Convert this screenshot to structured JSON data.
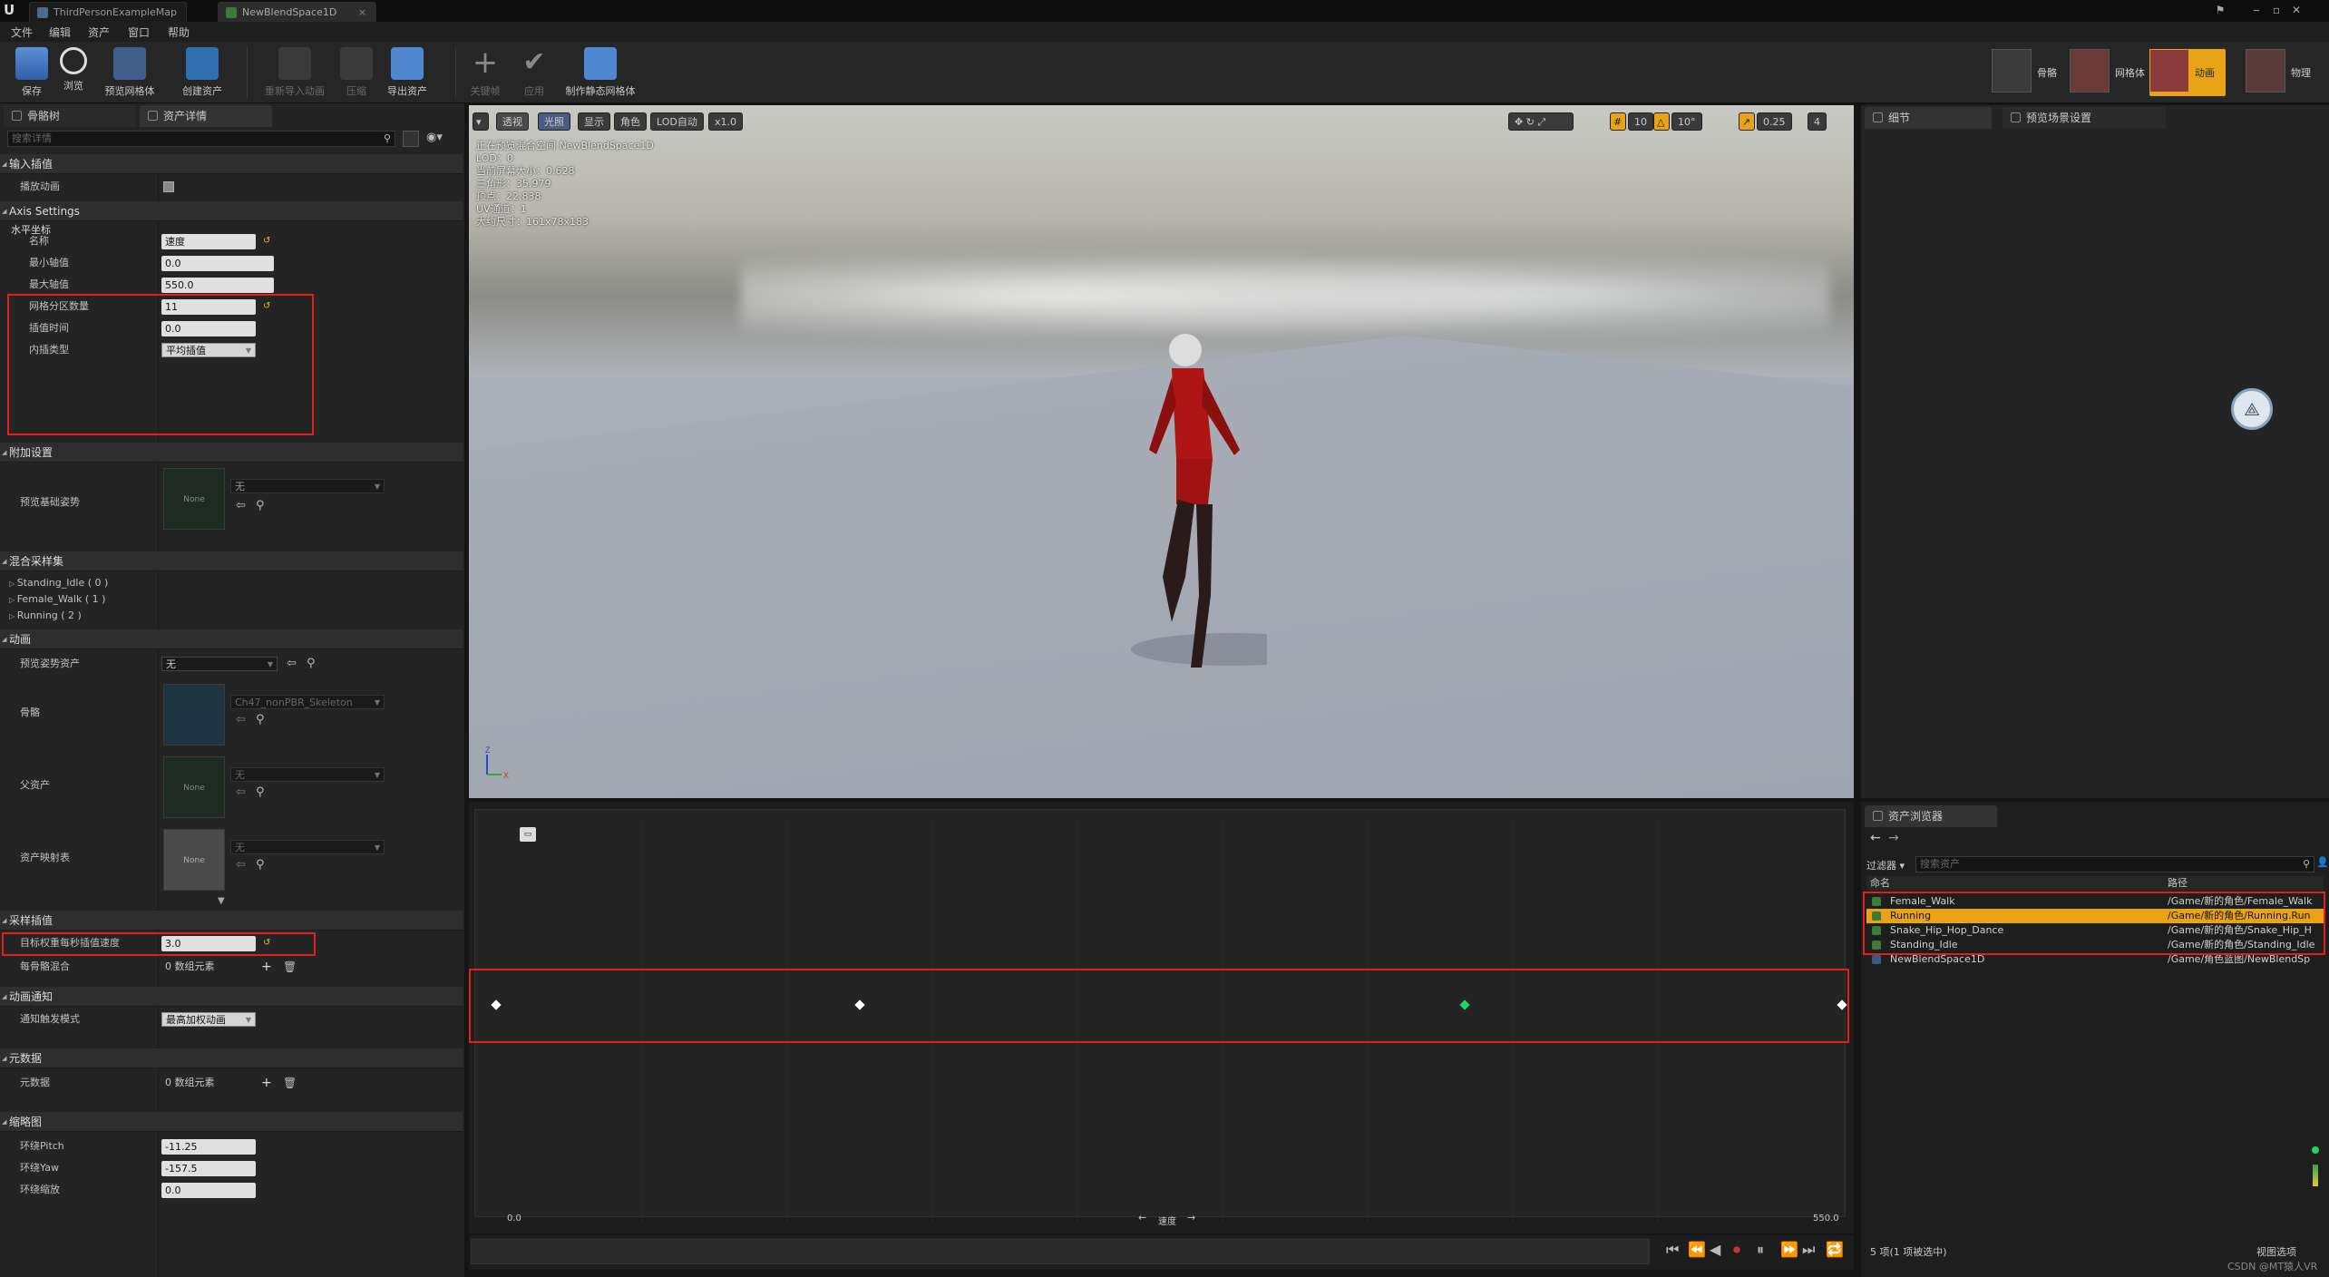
{
  "titlebar": {
    "tabs": [
      "ThirdPersonExampleMap",
      "NewBlendSpace1D"
    ]
  },
  "menubar": [
    "文件",
    "编辑",
    "资产",
    "窗口",
    "帮助"
  ],
  "toolbar": {
    "buttons": [
      "保存",
      "浏览",
      "预览网格体",
      "创建资产",
      "重新导入动画",
      "压缩",
      "导出资产",
      "关键帧",
      "应用",
      "制作静态网格体"
    ],
    "modes": [
      "骨骼",
      "网格体",
      "动画",
      "物理"
    ]
  },
  "left_panel": {
    "tabs": [
      "骨骼树",
      "资产详情"
    ],
    "search_placeholder": "搜索详情",
    "sections": {
      "input_interp": "输入插值",
      "play_anim_label": "播放动画",
      "axis_settings": "Axis Settings",
      "horizontal_axis": "水平坐标",
      "additive": "附加设置",
      "samples": "混合采样集",
      "animation": "动画",
      "sample_interp": "采样插值",
      "anim_notify": "动画通知",
      "metadata": "元数据",
      "thumbnail": "缩略图"
    },
    "axis": {
      "name_label": "名称",
      "name_value": "速度",
      "min_label": "最小轴值",
      "min_value": "0.0",
      "max_label": "最大轴值",
      "max_value": "550.0",
      "grid_label": "网格分区数量",
      "grid_value": "11",
      "interp_time_label": "插值时间",
      "interp_time_value": "0.0",
      "interp_type_label": "内插类型",
      "interp_type_value": "平均插值"
    },
    "preview_base_pose_label": "预览基础姿势",
    "none_text": "None",
    "wu": "无",
    "sample_items": [
      "Standing_Idle ( 0 )",
      "Female_Walk ( 1 )",
      "Running ( 2 )"
    ],
    "anim": {
      "preview_pose_label": "预览姿势资产",
      "skeleton_label": "骨骼",
      "skeleton_value": "Ch47_nonPBR_Skeleton",
      "parent_label": "父资产",
      "asset_map_label": "资产映射表"
    },
    "target_weight_label": "目标权重每秒插值速度",
    "target_weight_value": "3.0",
    "per_bone_label": "每骨骼混合",
    "array_elems": "0 数组元素",
    "notify_mode_label": "通知触发模式",
    "notify_mode_value": "最高加权动画",
    "meta_label": "元数据",
    "thumb": {
      "pitch_label": "环绕Pitch",
      "pitch_value": "-11.25",
      "yaw_label": "环绕Yaw",
      "yaw_value": "-157.5",
      "zoom_label": "环绕缩放",
      "zoom_value": "0.0"
    }
  },
  "viewport": {
    "buttons": [
      "透视",
      "光照",
      "显示",
      "角色",
      "LOD自动",
      "x1.0"
    ],
    "right_values": [
      "10",
      "10°",
      "0.25",
      "4"
    ],
    "info_lines": [
      "正在预览混合空间 NewBlendSpace1D",
      "LOD：0",
      "当前屏幕大小：0.628",
      "三角形：35,979",
      "顶点：22,838",
      "UV通道：1",
      "大约尺寸：161x78x183"
    ]
  },
  "blend_graph": {
    "x_min_label": "0.0",
    "x_max_label": "550.0",
    "axis_name": "速度",
    "sample_positions": [
      0,
      0.27,
      0.72,
      1.0
    ],
    "active_sample_index": 2
  },
  "right_panel": {
    "tabs": [
      "细节",
      "预览场景设置"
    ]
  },
  "asset_browser": {
    "tab": "资产浏览器",
    "filter_label": "过滤器",
    "search_placeholder": "搜索资产",
    "col_name": "命名",
    "col_path": "路径",
    "rows": [
      {
        "name": "Female_Walk",
        "path": "/Game/新的角色/Female_Walk"
      },
      {
        "name": "Running",
        "path": "/Game/新的角色/Running.Run"
      },
      {
        "name": "Snake_Hip_Hop_Dance",
        "path": "/Game/新的角色/Snake_Hip_H"
      },
      {
        "name": "Standing_Idle",
        "path": "/Game/新的角色/Standing_Idle"
      },
      {
        "name": "NewBlendSpace1D",
        "path": "/Game/角色蓝图/NewBlendSp"
      }
    ],
    "selected_index": 1,
    "status": "5 项(1 项被选中)",
    "view_options": "视图选项",
    "watermark": "CSDN @MT猿人VR"
  },
  "colors": {
    "accent_red": "#e0201a",
    "selected_orange": "#e8a317",
    "active_sample": "#1ed760"
  }
}
